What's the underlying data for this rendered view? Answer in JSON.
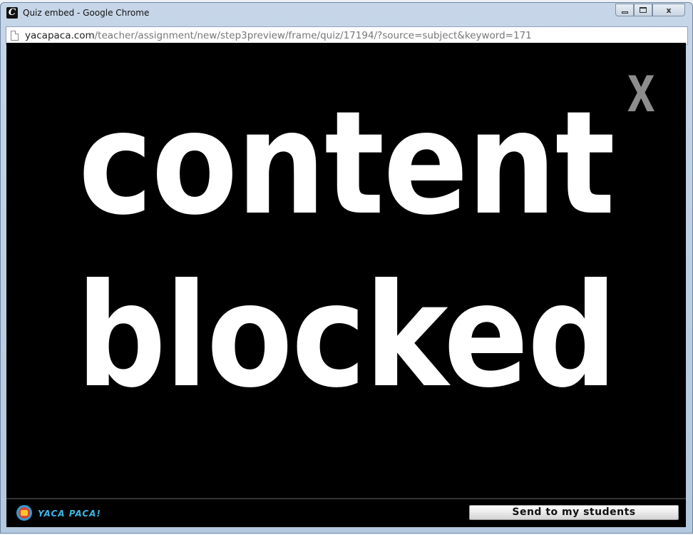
{
  "window": {
    "title": "Quiz embed - Google Chrome",
    "app_icon_letter": "C",
    "controls": {
      "close": "x"
    }
  },
  "address": {
    "host": "yacapaca.com",
    "path": "/teacher/assignment/new/step3preview/frame/quiz/17194/?source=subject&keyword=171"
  },
  "content": {
    "line1": "content",
    "line2": "blocked",
    "close_glyph": "x"
  },
  "footer": {
    "logo_text": "YACA PACA!",
    "send_label": "Send to my students"
  },
  "colors": {
    "content_bg": "#000000",
    "blocked_text": "#ffffff",
    "close_x": "#8d8d8d",
    "logo_text": "#3db6e6"
  },
  "icons": [
    "app-icon",
    "page-icon",
    "minimize-icon",
    "maximize-icon",
    "close-icon",
    "yacapaca-logo-icon"
  ]
}
